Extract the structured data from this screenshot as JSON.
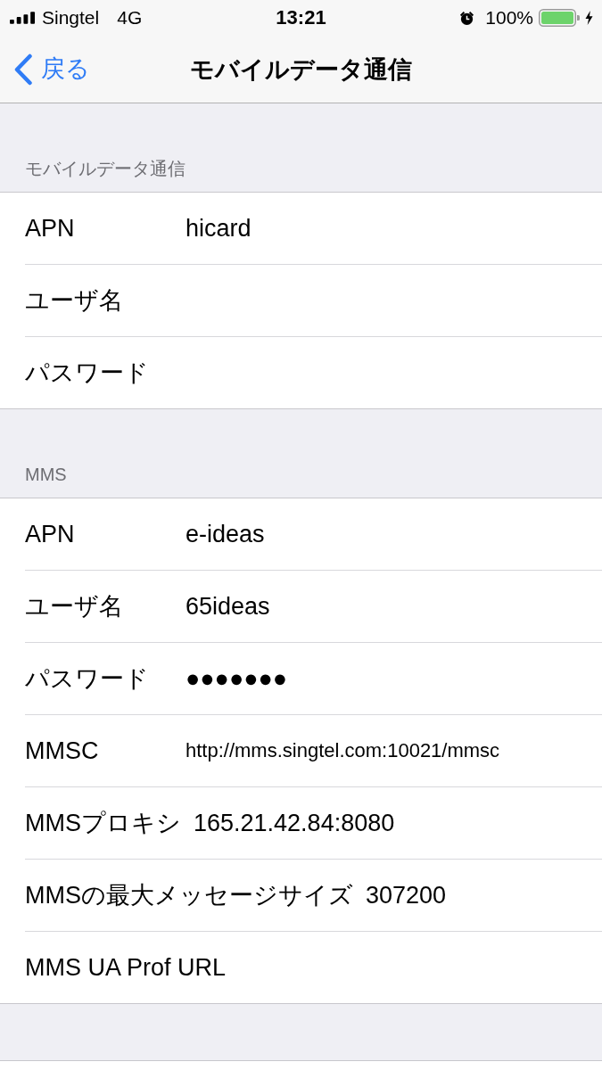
{
  "status_bar": {
    "carrier": "Singtel",
    "network": "4G",
    "time": "13:21",
    "battery": "100%"
  },
  "nav_bar": {
    "back": "戻る",
    "title": "モバイルデータ通信"
  },
  "sections": [
    {
      "header": "モバイルデータ通信",
      "rows": [
        {
          "label": "APN",
          "value": "hicard"
        },
        {
          "label": "ユーザ名"
        },
        {
          "label": "パスワード"
        }
      ]
    },
    {
      "header": "MMS",
      "rows": [
        {
          "label": "APN",
          "value": "e-ideas"
        },
        {
          "label": "ユーザ名",
          "value": "65ideas"
        },
        {
          "label": "パスワード",
          "value": "●●●●●●●"
        },
        {
          "label": "MMSC",
          "value": "http://mms.singtel.com:10021/mmsc"
        },
        {
          "label": "MMSプロキシ",
          "value": "165.21.42.84:8080"
        },
        {
          "label": "MMSの最大メッセージサイズ",
          "value": "307200"
        },
        {
          "label": "MMS UA Prof URL"
        }
      ]
    }
  ]
}
